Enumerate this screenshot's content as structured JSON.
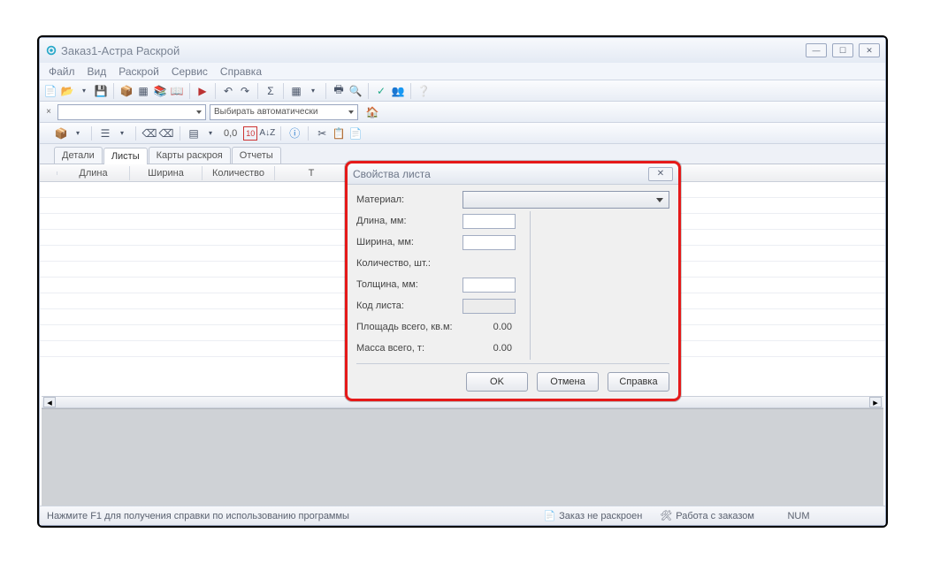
{
  "window": {
    "title": "Заказ1-Астра Раскрой"
  },
  "menu": {
    "file": "Файл",
    "view": "Вид",
    "cut": "Раскрой",
    "service": "Сервис",
    "help": "Справка"
  },
  "combo2": {
    "label": "Выбирать автоматически"
  },
  "toolbar3": {
    "zero": "0,0",
    "ten": "10",
    "az": "A↓Z"
  },
  "tabs": {
    "details": "Детали",
    "sheets": "Листы",
    "maps": "Карты раскроя",
    "reports": "Отчеты"
  },
  "grid": {
    "headers": {
      "length": "Длина",
      "width": "Ширина",
      "qty": "Количество",
      "t": "Т"
    }
  },
  "dialog": {
    "title": "Свойства листа",
    "fields": {
      "material": "Материал:",
      "length": "Длина, мм:",
      "width": "Ширина, мм:",
      "qty": "Количество, шт.:",
      "thickness": "Толщина, мм:",
      "code": "Код листа:",
      "area": "Площадь всего, кв.м:",
      "mass": "Масса всего, т:"
    },
    "values": {
      "area": "0.00",
      "mass": "0.00"
    },
    "buttons": {
      "ok": "OK",
      "cancel": "Отмена",
      "help": "Справка"
    }
  },
  "status": {
    "hint": "Нажмите F1 для получения справки по использованию программы",
    "status1": "Заказ не раскроен",
    "status2": "Работа с заказом",
    "num": "NUM"
  }
}
